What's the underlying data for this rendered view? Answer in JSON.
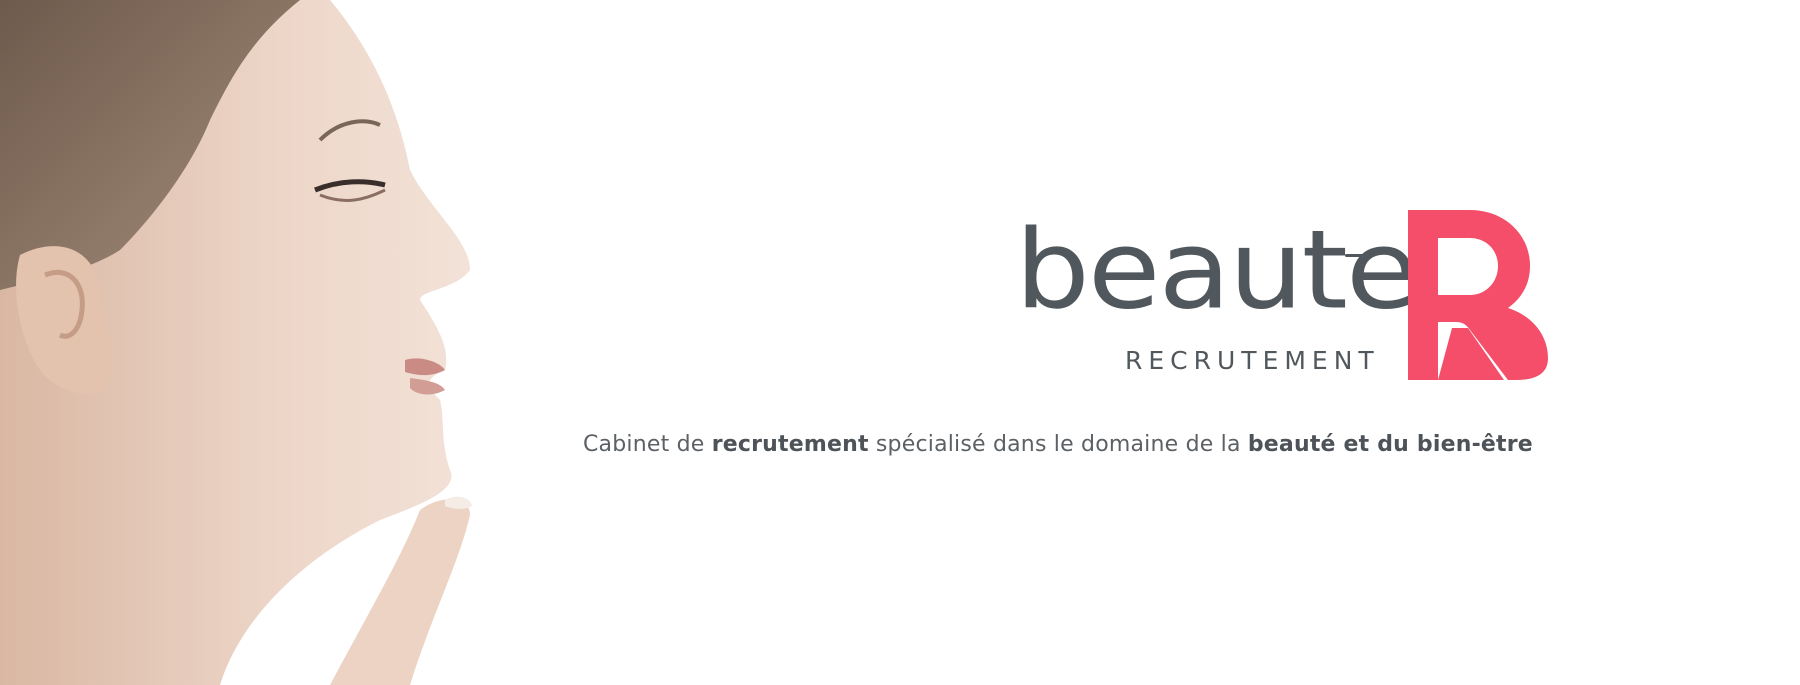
{
  "logo": {
    "wordmark": "beaute",
    "subtitle": "RECRUTEMENT",
    "accent_color": "#f44e6a",
    "text_color": "#51585d"
  },
  "tagline": {
    "part1": "Cabinet de ",
    "bold1": "recrutement",
    "part2": " spécialisé dans le domaine de la ",
    "bold2": "beauté et du bien-être"
  }
}
